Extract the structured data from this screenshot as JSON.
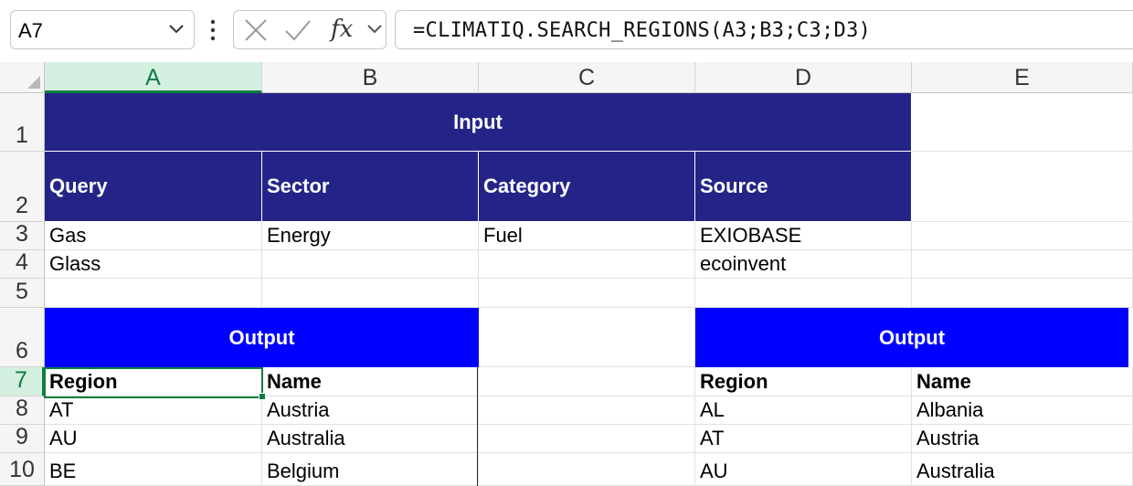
{
  "formula_bar": {
    "name_box": "A7",
    "fx_label": "fx",
    "formula": "=CLIMATIQ.SEARCH_REGIONS(A3;B3;C3;D3)"
  },
  "columns": [
    "A",
    "B",
    "C",
    "D",
    "E"
  ],
  "rows": [
    "1",
    "2",
    "3",
    "4",
    "5",
    "6",
    "7",
    "8",
    "9",
    "10"
  ],
  "sheet": {
    "input_title": "Input",
    "input_headers": [
      "Query",
      "Sector",
      "Category",
      "Source"
    ],
    "row3": [
      "Gas",
      "Energy",
      "Fuel",
      "EXIOBASE"
    ],
    "row4": [
      "Glass",
      "",
      "",
      "ecoinvent"
    ],
    "output_left": {
      "title": "Output",
      "headers": [
        "Region",
        "Name"
      ],
      "rows": [
        [
          "AT",
          "Austria"
        ],
        [
          "AU",
          "Australia"
        ],
        [
          "BE",
          "Belgium"
        ]
      ]
    },
    "output_right": {
      "title": "Output",
      "headers": [
        "Region",
        "Name"
      ],
      "rows": [
        [
          "AL",
          "Albania"
        ],
        [
          "AT",
          "Austria"
        ],
        [
          "AU",
          "Australia"
        ]
      ]
    }
  },
  "colors": {
    "input_fill": "#242488",
    "output_fill": "#0000ff",
    "selection": "#107c41"
  }
}
